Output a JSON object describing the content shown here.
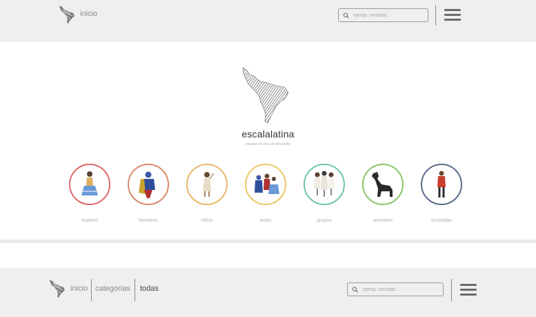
{
  "colors": {
    "header_bg": "#efefef",
    "mujeres": "#e06a6a",
    "hombres": "#d98a6a",
    "ninos": "#e8b86a",
    "todas": "#e8c866",
    "grupos": "#6ec4a8",
    "animales": "#8cc46a",
    "ilustradas": "#5a6a8a"
  },
  "top_header": {
    "home_label": "inicio",
    "search_placeholder": "ejemp: sentado"
  },
  "hero": {
    "brand": "escalalatina",
    "tagline": "escalas en vías de desarrollo"
  },
  "categories": [
    {
      "label": "mujeres",
      "icon": "woman-figure-icon"
    },
    {
      "label": "hombres",
      "icon": "wrestler-figure-icon"
    },
    {
      "label": "niños",
      "icon": "child-figure-icon"
    },
    {
      "label": "todas",
      "icon": "group-figures-icon"
    },
    {
      "label": "grupos",
      "icon": "group-people-icon"
    },
    {
      "label": "animales",
      "icon": "dog-icon"
    },
    {
      "label": "ilustradas",
      "icon": "illustrated-man-icon"
    }
  ],
  "bottom_header": {
    "home_label": "inicio",
    "categories_label": "categorias",
    "current_label": "todas",
    "search_placeholder": "ejemp: sentado"
  }
}
